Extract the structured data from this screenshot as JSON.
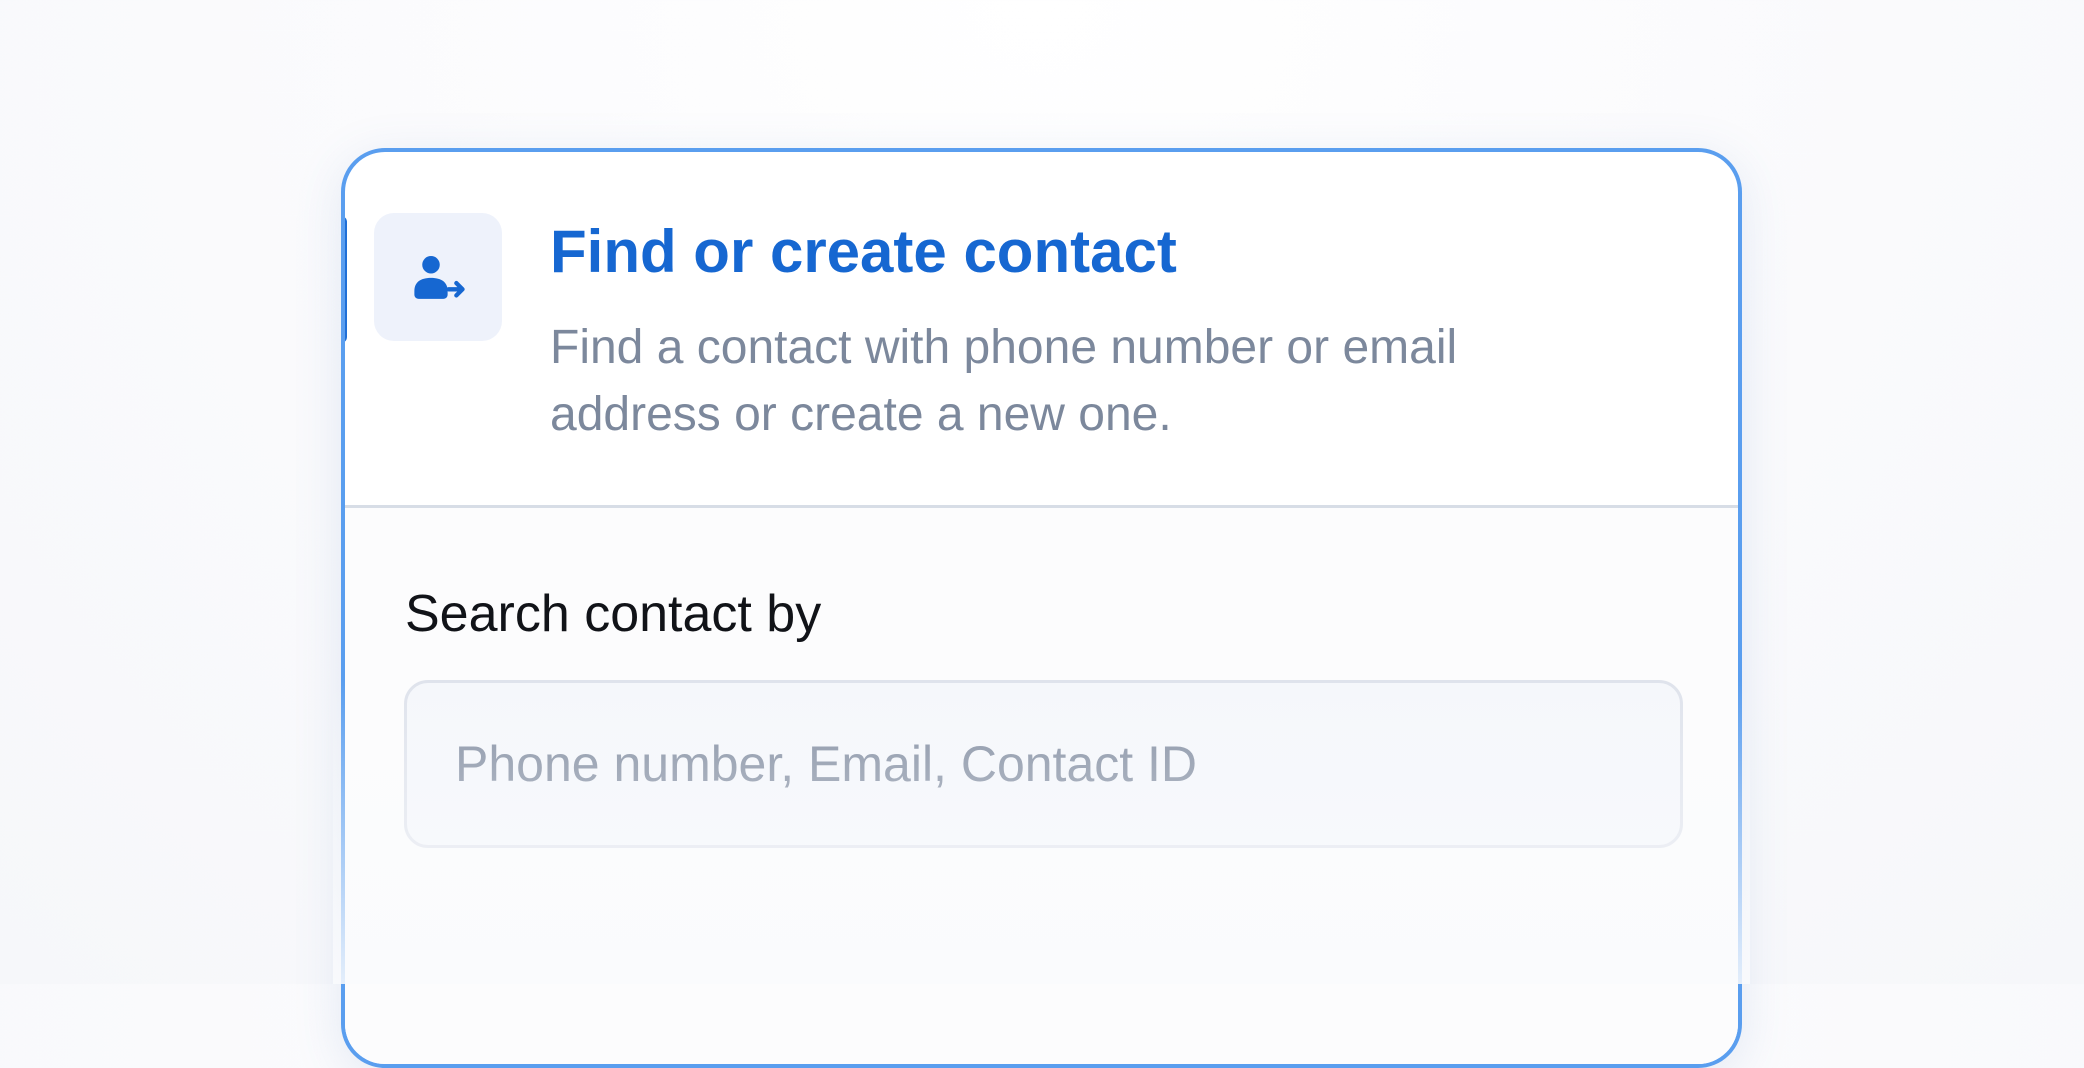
{
  "step": {
    "icon": "user-arrow-icon",
    "title": "Find or create contact",
    "description": "Find a contact with phone number or email address or create a new one.",
    "accent_color": "#1667d1"
  },
  "search": {
    "label": "Search contact by",
    "value": "",
    "placeholder": "Phone number, Email, Contact ID"
  }
}
